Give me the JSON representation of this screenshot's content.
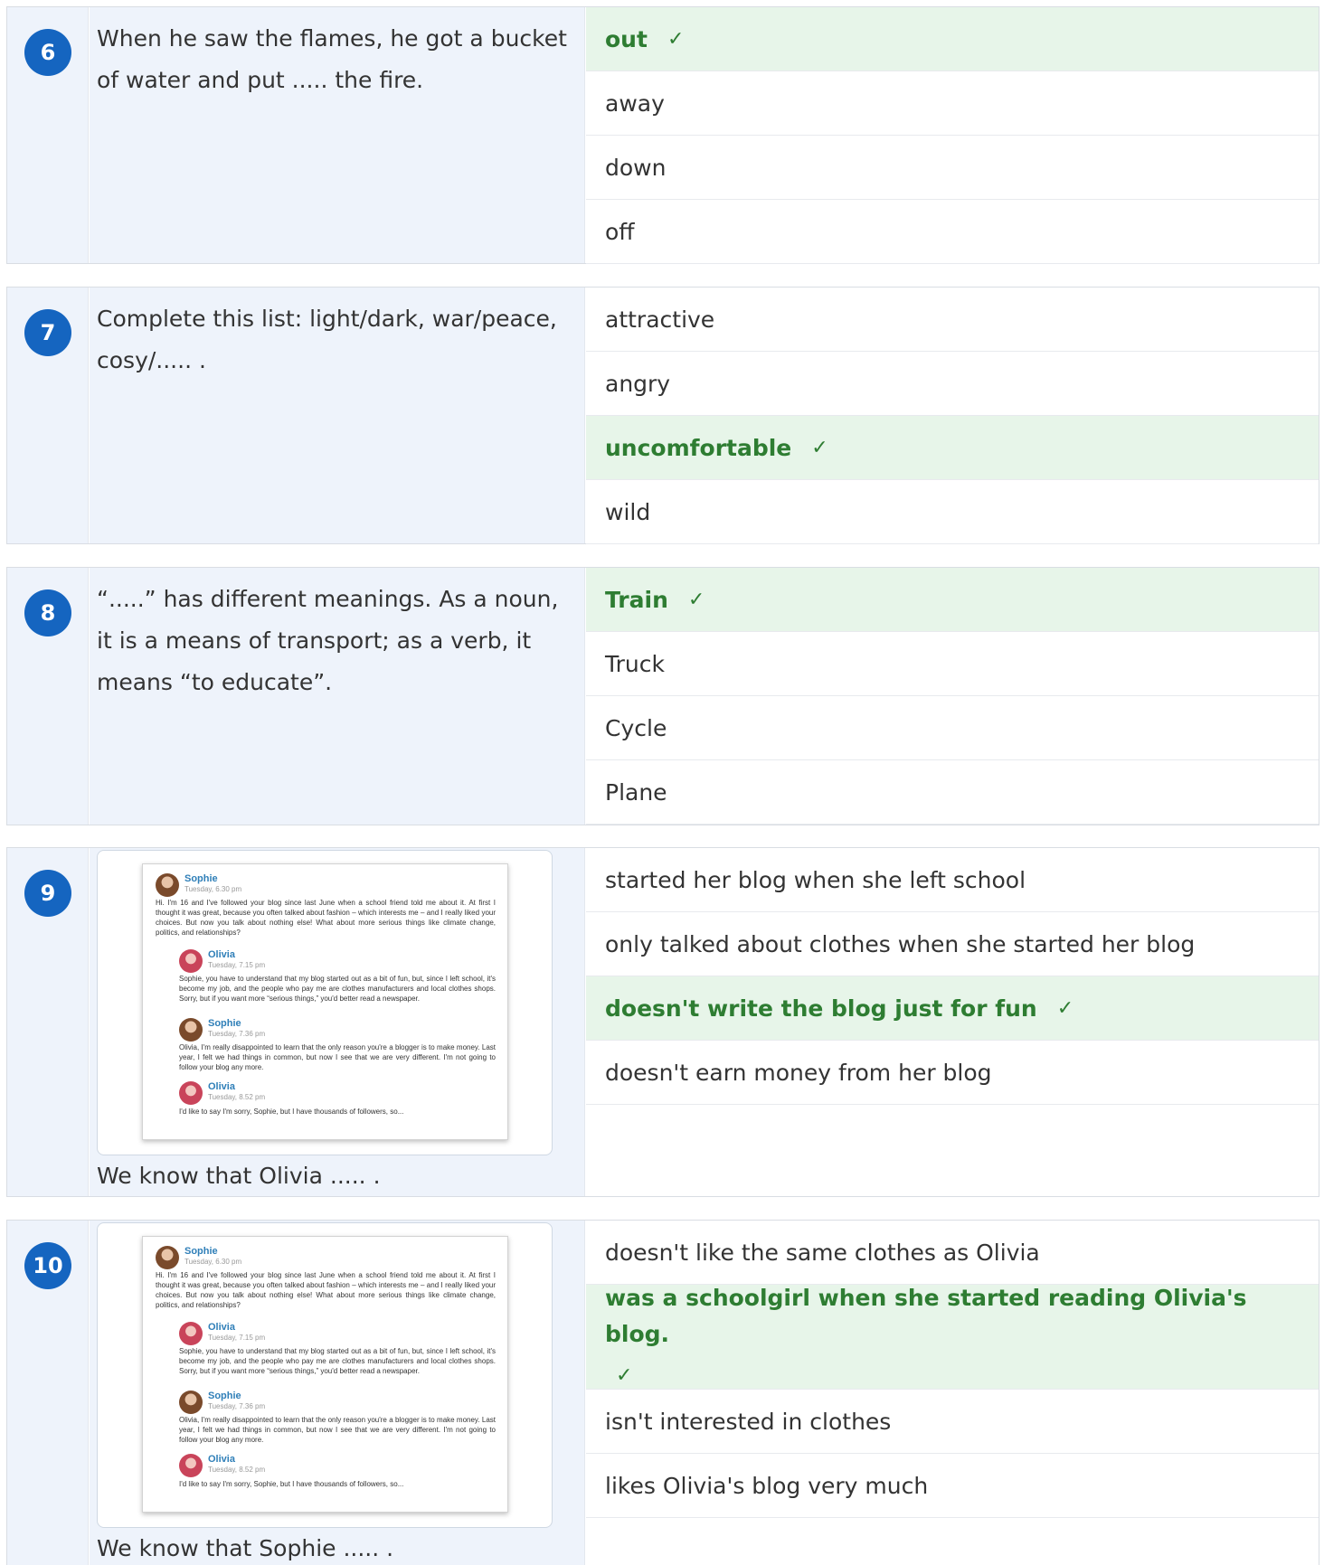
{
  "questions": [
    {
      "number": "6",
      "prompt": "When he saw the flames, he got a bucket of water and put ..... the fire.",
      "options": [
        "out",
        "away",
        "down",
        "off"
      ]
    },
    {
      "number": "7",
      "prompt": "Complete this list: light/dark, war/peace, cosy/..... .",
      "options": [
        "attractive",
        "angry",
        "uncomfortable",
        "wild"
      ]
    },
    {
      "number": "8",
      "prompt": "“.....” has different meanings. As a noun, it is a means of transport; as a verb, it means “to educate”.",
      "options": [
        "Train",
        "Truck",
        "Cycle",
        "Plane"
      ]
    },
    {
      "number": "9",
      "caption": "We know that Olivia ..... .",
      "options": [
        "started her blog when she left school",
        "only talked about clothes when she started her blog",
        "doesn't write the blog just for fun",
        "doesn't earn money from her blog"
      ]
    },
    {
      "number": "10",
      "caption": "We know that Sophie ..... .",
      "options": [
        "doesn't like the same clothes as Olivia",
        "was a schoolgirl when she started reading Olivia's blog.",
        "isn't interested in clothes",
        "likes Olivia's blog very much"
      ]
    }
  ],
  "check_mark": "✓",
  "blog": {
    "messages": [
      {
        "author": "Sophie",
        "time": "Tuesday, 6.30 pm",
        "text": "Hi. I'm 16 and I've followed your blog since last June when a school friend told me about it. At first I thought it was great, because you often talked about fashion – which interests me – and I really liked your choices. But now you talk about nothing else! What about more serious things like climate change, politics, and relationships?"
      },
      {
        "author": "Olivia",
        "time": "Tuesday, 7.15 pm",
        "text": "Sophie, you have to understand that my blog started out as a bit of fun, but, since I left school, it's become my job, and the people who pay me are clothes manufacturers and local clothes shops. Sorry, but if you want more “serious things,” you'd better read a newspaper."
      },
      {
        "author": "Sophie",
        "time": "Tuesday, 7.36 pm",
        "text": "Olivia, I'm really disappointed to learn that the only reason you're a blogger is to make money. Last year, I felt we had things in common, but now I see that we are very different. I'm not going to follow your blog any more."
      },
      {
        "author": "Olivia",
        "time": "Tuesday, 8.52 pm",
        "text": "I'd like to say I'm sorry, Sophie, but I have thousands of followers, so..."
      }
    ]
  },
  "colors": {
    "badge": "#1565c0",
    "correct_bg": "#e7f5e9",
    "correct_text": "#2e7d32",
    "question_bg": "#eef3fb"
  }
}
